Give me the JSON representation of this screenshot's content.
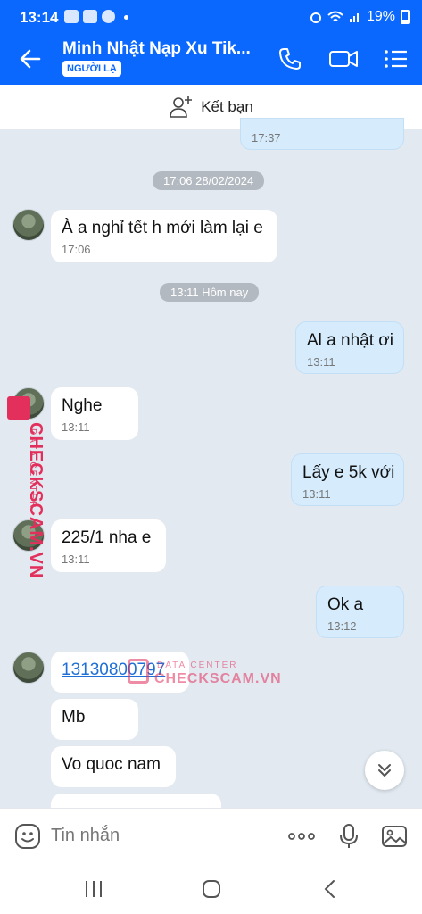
{
  "status_bar": {
    "time": "13:14",
    "battery_percent": "19%"
  },
  "header": {
    "title": "Minh Nhật Nạp Xu Tik...",
    "badge": "NGƯỜI LẠ",
    "icons": [
      "back-arrow-icon",
      "phone-icon",
      "video-call-icon",
      "menu-list-icon"
    ]
  },
  "friend_bar": {
    "label": "Kết bạn"
  },
  "messages": {
    "prev_out": {
      "time": "17:37"
    },
    "date1": "17:06 28/02/2024",
    "m1": {
      "text": "À a nghỉ tết h mới làm lại e",
      "time": "17:06"
    },
    "date2": "13:11 Hôm nay",
    "m2": {
      "text": "Al a nhật ơi",
      "time": "13:11"
    },
    "m3": {
      "text": "Nghe",
      "time": "13:11"
    },
    "m4": {
      "text": "Lấy e 5k với",
      "time": "13:11"
    },
    "m5": {
      "text": "225/1 nha e",
      "time": "13:11"
    },
    "m6": {
      "text": "Ok a",
      "time": "13:12"
    },
    "m7": {
      "text": "13130800797"
    },
    "m8": {
      "text": "Mb"
    },
    "m9": {
      "text": "Vo quoc nam"
    }
  },
  "watermark": {
    "brand": "CHECKSCAM.VN",
    "tag": "DATA CENTER"
  },
  "composer": {
    "placeholder": "Tin nhắn"
  },
  "colors": {
    "primary": "#0a68ff",
    "chat_bg": "#e2e9f1",
    "outgoing_bubble": "#d6ecfd",
    "watermark": "#e32f5c"
  }
}
